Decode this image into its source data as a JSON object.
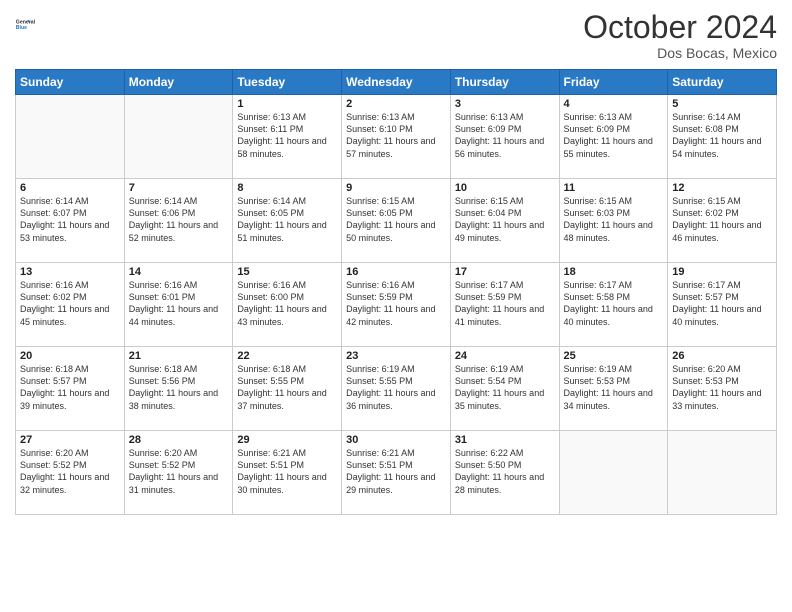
{
  "header": {
    "logo_line1": "General",
    "logo_line2": "Blue",
    "month": "October 2024",
    "location": "Dos Bocas, Mexico"
  },
  "weekdays": [
    "Sunday",
    "Monday",
    "Tuesday",
    "Wednesday",
    "Thursday",
    "Friday",
    "Saturday"
  ],
  "weeks": [
    [
      {
        "day": "",
        "info": ""
      },
      {
        "day": "",
        "info": ""
      },
      {
        "day": "1",
        "info": "Sunrise: 6:13 AM\nSunset: 6:11 PM\nDaylight: 11 hours and 58 minutes."
      },
      {
        "day": "2",
        "info": "Sunrise: 6:13 AM\nSunset: 6:10 PM\nDaylight: 11 hours and 57 minutes."
      },
      {
        "day": "3",
        "info": "Sunrise: 6:13 AM\nSunset: 6:09 PM\nDaylight: 11 hours and 56 minutes."
      },
      {
        "day": "4",
        "info": "Sunrise: 6:13 AM\nSunset: 6:09 PM\nDaylight: 11 hours and 55 minutes."
      },
      {
        "day": "5",
        "info": "Sunrise: 6:14 AM\nSunset: 6:08 PM\nDaylight: 11 hours and 54 minutes."
      }
    ],
    [
      {
        "day": "6",
        "info": "Sunrise: 6:14 AM\nSunset: 6:07 PM\nDaylight: 11 hours and 53 minutes."
      },
      {
        "day": "7",
        "info": "Sunrise: 6:14 AM\nSunset: 6:06 PM\nDaylight: 11 hours and 52 minutes."
      },
      {
        "day": "8",
        "info": "Sunrise: 6:14 AM\nSunset: 6:05 PM\nDaylight: 11 hours and 51 minutes."
      },
      {
        "day": "9",
        "info": "Sunrise: 6:15 AM\nSunset: 6:05 PM\nDaylight: 11 hours and 50 minutes."
      },
      {
        "day": "10",
        "info": "Sunrise: 6:15 AM\nSunset: 6:04 PM\nDaylight: 11 hours and 49 minutes."
      },
      {
        "day": "11",
        "info": "Sunrise: 6:15 AM\nSunset: 6:03 PM\nDaylight: 11 hours and 48 minutes."
      },
      {
        "day": "12",
        "info": "Sunrise: 6:15 AM\nSunset: 6:02 PM\nDaylight: 11 hours and 46 minutes."
      }
    ],
    [
      {
        "day": "13",
        "info": "Sunrise: 6:16 AM\nSunset: 6:02 PM\nDaylight: 11 hours and 45 minutes."
      },
      {
        "day": "14",
        "info": "Sunrise: 6:16 AM\nSunset: 6:01 PM\nDaylight: 11 hours and 44 minutes."
      },
      {
        "day": "15",
        "info": "Sunrise: 6:16 AM\nSunset: 6:00 PM\nDaylight: 11 hours and 43 minutes."
      },
      {
        "day": "16",
        "info": "Sunrise: 6:16 AM\nSunset: 5:59 PM\nDaylight: 11 hours and 42 minutes."
      },
      {
        "day": "17",
        "info": "Sunrise: 6:17 AM\nSunset: 5:59 PM\nDaylight: 11 hours and 41 minutes."
      },
      {
        "day": "18",
        "info": "Sunrise: 6:17 AM\nSunset: 5:58 PM\nDaylight: 11 hours and 40 minutes."
      },
      {
        "day": "19",
        "info": "Sunrise: 6:17 AM\nSunset: 5:57 PM\nDaylight: 11 hours and 40 minutes."
      }
    ],
    [
      {
        "day": "20",
        "info": "Sunrise: 6:18 AM\nSunset: 5:57 PM\nDaylight: 11 hours and 39 minutes."
      },
      {
        "day": "21",
        "info": "Sunrise: 6:18 AM\nSunset: 5:56 PM\nDaylight: 11 hours and 38 minutes."
      },
      {
        "day": "22",
        "info": "Sunrise: 6:18 AM\nSunset: 5:55 PM\nDaylight: 11 hours and 37 minutes."
      },
      {
        "day": "23",
        "info": "Sunrise: 6:19 AM\nSunset: 5:55 PM\nDaylight: 11 hours and 36 minutes."
      },
      {
        "day": "24",
        "info": "Sunrise: 6:19 AM\nSunset: 5:54 PM\nDaylight: 11 hours and 35 minutes."
      },
      {
        "day": "25",
        "info": "Sunrise: 6:19 AM\nSunset: 5:53 PM\nDaylight: 11 hours and 34 minutes."
      },
      {
        "day": "26",
        "info": "Sunrise: 6:20 AM\nSunset: 5:53 PM\nDaylight: 11 hours and 33 minutes."
      }
    ],
    [
      {
        "day": "27",
        "info": "Sunrise: 6:20 AM\nSunset: 5:52 PM\nDaylight: 11 hours and 32 minutes."
      },
      {
        "day": "28",
        "info": "Sunrise: 6:20 AM\nSunset: 5:52 PM\nDaylight: 11 hours and 31 minutes."
      },
      {
        "day": "29",
        "info": "Sunrise: 6:21 AM\nSunset: 5:51 PM\nDaylight: 11 hours and 30 minutes."
      },
      {
        "day": "30",
        "info": "Sunrise: 6:21 AM\nSunset: 5:51 PM\nDaylight: 11 hours and 29 minutes."
      },
      {
        "day": "31",
        "info": "Sunrise: 6:22 AM\nSunset: 5:50 PM\nDaylight: 11 hours and 28 minutes."
      },
      {
        "day": "",
        "info": ""
      },
      {
        "day": "",
        "info": ""
      }
    ]
  ]
}
